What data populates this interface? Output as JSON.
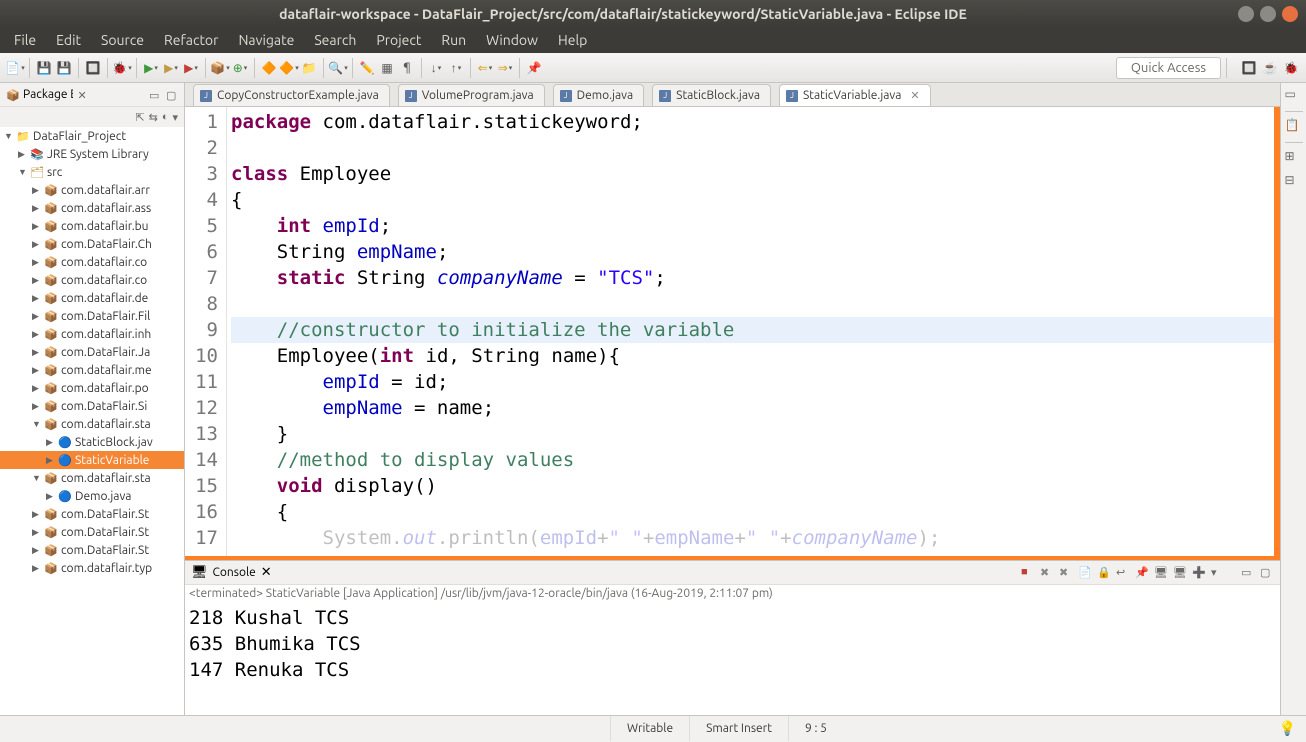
{
  "window": {
    "title": "dataflair-workspace - DataFlair_Project/src/com/dataflair/statickeyword/StaticVariable.java - Eclipse IDE"
  },
  "menu": {
    "items": [
      "File",
      "Edit",
      "Source",
      "Refactor",
      "Navigate",
      "Search",
      "Project",
      "Run",
      "Window",
      "Help"
    ]
  },
  "toolbar": {
    "quick_access": "Quick Access"
  },
  "package_explorer": {
    "title": "Package Ex",
    "tree": [
      {
        "depth": 0,
        "expand": "▼",
        "icon": "proj",
        "label": "DataFlair_Project"
      },
      {
        "depth": 1,
        "expand": "▶",
        "icon": "lib",
        "label": "JRE System Library"
      },
      {
        "depth": 1,
        "expand": "▼",
        "icon": "src",
        "label": "src"
      },
      {
        "depth": 2,
        "expand": "▶",
        "icon": "pkg",
        "label": "com.dataflair.arr"
      },
      {
        "depth": 2,
        "expand": "▶",
        "icon": "pkg",
        "label": "com.dataflair.ass"
      },
      {
        "depth": 2,
        "expand": "▶",
        "icon": "pkg",
        "label": "com.dataflair.bu"
      },
      {
        "depth": 2,
        "expand": "▶",
        "icon": "pkg",
        "label": "com.DataFlair.Ch"
      },
      {
        "depth": 2,
        "expand": "▶",
        "icon": "pkg",
        "label": "com.dataflair.co"
      },
      {
        "depth": 2,
        "expand": "▶",
        "icon": "pkg",
        "label": "com.dataflair.co"
      },
      {
        "depth": 2,
        "expand": "▶",
        "icon": "pkg",
        "label": "com.dataflair.de"
      },
      {
        "depth": 2,
        "expand": "▶",
        "icon": "pkg",
        "label": "com.DataFlair.Fil"
      },
      {
        "depth": 2,
        "expand": "▶",
        "icon": "pkg",
        "label": "com.dataflair.inh"
      },
      {
        "depth": 2,
        "expand": "▶",
        "icon": "pkg",
        "label": "com.DataFlair.Ja"
      },
      {
        "depth": 2,
        "expand": "▶",
        "icon": "pkg",
        "label": "com.dataflair.me"
      },
      {
        "depth": 2,
        "expand": "▶",
        "icon": "pkg",
        "label": "com.dataflair.po"
      },
      {
        "depth": 2,
        "expand": "▶",
        "icon": "pkg",
        "label": "com.DataFlair.Si"
      },
      {
        "depth": 2,
        "expand": "▼",
        "icon": "pkg",
        "label": "com.dataflair.sta"
      },
      {
        "depth": 3,
        "expand": "▶",
        "icon": "java",
        "label": "StaticBlock.jav"
      },
      {
        "depth": 3,
        "expand": "▶",
        "icon": "java",
        "label": "StaticVariable",
        "selected": true
      },
      {
        "depth": 2,
        "expand": "▼",
        "icon": "pkg",
        "label": "com.dataflair.sta"
      },
      {
        "depth": 3,
        "expand": "▶",
        "icon": "java",
        "label": "Demo.java"
      },
      {
        "depth": 2,
        "expand": "▶",
        "icon": "pkg",
        "label": "com.DataFlair.St"
      },
      {
        "depth": 2,
        "expand": "▶",
        "icon": "pkg",
        "label": "com.DataFlair.St"
      },
      {
        "depth": 2,
        "expand": "▶",
        "icon": "pkg",
        "label": "com.DataFlair.St"
      },
      {
        "depth": 2,
        "expand": "▶",
        "icon": "pkg",
        "label": "com.dataflair.typ"
      }
    ]
  },
  "editor_tabs": [
    {
      "label": "CopyConstructorExample.java"
    },
    {
      "label": "VolumeProgram.java"
    },
    {
      "label": "Demo.java"
    },
    {
      "label": "StaticBlock.java"
    },
    {
      "label": "StaticVariable.java",
      "active": true,
      "closeable": true
    }
  ],
  "code": {
    "lines": [
      {
        "n": 1,
        "tokens": [
          [
            "kw",
            "package"
          ],
          [
            "sp",
            " "
          ],
          [
            "typ",
            "com.dataflair.statickeyword"
          ],
          [
            "p",
            ";"
          ]
        ]
      },
      {
        "n": 2,
        "tokens": []
      },
      {
        "n": 3,
        "tokens": [
          [
            "kw",
            "class"
          ],
          [
            "sp",
            " "
          ],
          [
            "typ",
            "Employee"
          ]
        ]
      },
      {
        "n": 4,
        "tokens": [
          [
            "p",
            "{"
          ]
        ]
      },
      {
        "n": 5,
        "tokens": [
          [
            "ind",
            "    "
          ],
          [
            "kw",
            "int"
          ],
          [
            "sp",
            " "
          ],
          [
            "fld",
            "empId"
          ],
          [
            "p",
            ";"
          ]
        ]
      },
      {
        "n": 6,
        "tokens": [
          [
            "ind",
            "    "
          ],
          [
            "typ",
            "String"
          ],
          [
            "sp",
            " "
          ],
          [
            "fld",
            "empName"
          ],
          [
            "p",
            ";"
          ]
        ]
      },
      {
        "n": 7,
        "tokens": [
          [
            "ind",
            "    "
          ],
          [
            "kw",
            "static"
          ],
          [
            "sp",
            " "
          ],
          [
            "typ",
            "String"
          ],
          [
            "sp",
            " "
          ],
          [
            "sfld",
            "companyName"
          ],
          [
            "sp",
            " "
          ],
          [
            "p",
            "= "
          ],
          [
            "str",
            "\"TCS\""
          ],
          [
            "p",
            ";"
          ]
        ]
      },
      {
        "n": 8,
        "tokens": []
      },
      {
        "n": 9,
        "highlight": true,
        "tokens": [
          [
            "ind",
            "    "
          ],
          [
            "cm",
            "//constructor to initialize the variable"
          ]
        ]
      },
      {
        "n": 10,
        "marker": true,
        "tokens": [
          [
            "ind",
            "    "
          ],
          [
            "typ",
            "Employee"
          ],
          [
            "p",
            "("
          ],
          [
            "kw",
            "int"
          ],
          [
            "sp",
            " "
          ],
          [
            "typ",
            "id"
          ],
          [
            "p",
            ", "
          ],
          [
            "typ",
            "String"
          ],
          [
            "sp",
            " "
          ],
          [
            "typ",
            "name"
          ],
          [
            "p",
            "){"
          ]
        ]
      },
      {
        "n": 11,
        "tokens": [
          [
            "ind",
            "        "
          ],
          [
            "fld",
            "empId"
          ],
          [
            "sp",
            " "
          ],
          [
            "p",
            "= "
          ],
          [
            "typ",
            "id"
          ],
          [
            "p",
            ";"
          ]
        ]
      },
      {
        "n": 12,
        "tokens": [
          [
            "ind",
            "        "
          ],
          [
            "fld",
            "empName"
          ],
          [
            "sp",
            " "
          ],
          [
            "p",
            "= "
          ],
          [
            "typ",
            "name"
          ],
          [
            "p",
            ";"
          ]
        ]
      },
      {
        "n": 13,
        "tokens": [
          [
            "ind",
            "    "
          ],
          [
            "p",
            "}"
          ]
        ]
      },
      {
        "n": 14,
        "tokens": [
          [
            "ind",
            "    "
          ],
          [
            "cm",
            "//method to display values"
          ]
        ]
      },
      {
        "n": 15,
        "marker": true,
        "tokens": [
          [
            "ind",
            "    "
          ],
          [
            "kw",
            "void"
          ],
          [
            "sp",
            " "
          ],
          [
            "typ",
            "display"
          ],
          [
            "p",
            "()"
          ]
        ]
      },
      {
        "n": 16,
        "tokens": [
          [
            "ind",
            "    "
          ],
          [
            "p",
            "{"
          ]
        ]
      },
      {
        "n": 17,
        "cut": true,
        "tokens": [
          [
            "ind",
            "        "
          ],
          [
            "typ",
            "System."
          ],
          [
            "sfld",
            "out"
          ],
          [
            "typ",
            ".println("
          ],
          [
            "fld",
            "empId"
          ],
          [
            "p",
            "+"
          ],
          [
            "str",
            "\" \""
          ],
          [
            "p",
            "+"
          ],
          [
            "fld",
            "empName"
          ],
          [
            "p",
            "+"
          ],
          [
            "str",
            "\" \""
          ],
          [
            "p",
            "+"
          ],
          [
            "sfld",
            "companyName"
          ],
          [
            "p",
            ");"
          ]
        ]
      }
    ]
  },
  "console": {
    "title": "Console",
    "info": "<terminated> StaticVariable [Java Application] /usr/lib/jvm/java-12-oracle/bin/java (16-Aug-2019, 2:11:07 pm)",
    "output": "218 Kushal TCS\n635 Bhumika TCS\n147 Renuka TCS"
  },
  "statusbar": {
    "mode": "Writable",
    "insert": "Smart Insert",
    "pos": "9 : 5"
  }
}
